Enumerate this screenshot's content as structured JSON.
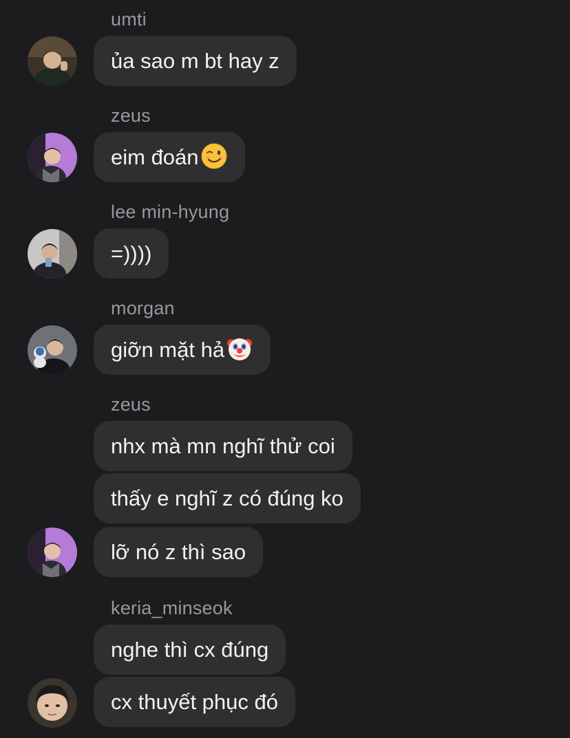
{
  "messages": {
    "g1": {
      "sender": "umti",
      "avatar": "avatar-umti",
      "bubbles": [
        "ủa sao m bt hay z"
      ]
    },
    "g2": {
      "sender": "zeus",
      "avatar": "avatar-zeus",
      "bubbles": [
        "eim đoán"
      ],
      "emoji": "winking-face-emoji"
    },
    "g3": {
      "sender": "lee min-hyung",
      "avatar": "avatar-lee-min-hyung",
      "bubbles": [
        "=))))"
      ]
    },
    "g4": {
      "sender": "morgan",
      "avatar": "avatar-morgan",
      "bubbles": [
        "giỡn mặt hả"
      ],
      "emoji": "clown-face-emoji"
    },
    "g5": {
      "sender": "zeus",
      "avatar": "avatar-zeus",
      "bubbles": [
        "nhx mà mn nghĩ thử coi",
        "thấy e nghĩ z có đúng ko",
        "lỡ nó z thì sao"
      ]
    },
    "g6": {
      "sender": "keria_minseok",
      "avatar": "avatar-keria-minseok",
      "bubbles": [
        "nghe thì cx đúng",
        "cx thuyết phục đó"
      ]
    }
  },
  "colors": {
    "background": "#1c1c1e",
    "bubble": "#2f2f31",
    "sender_text": "#98989d",
    "message_text": "#f2f2f2",
    "zeus_avatar_bg": "#b57bd6"
  }
}
